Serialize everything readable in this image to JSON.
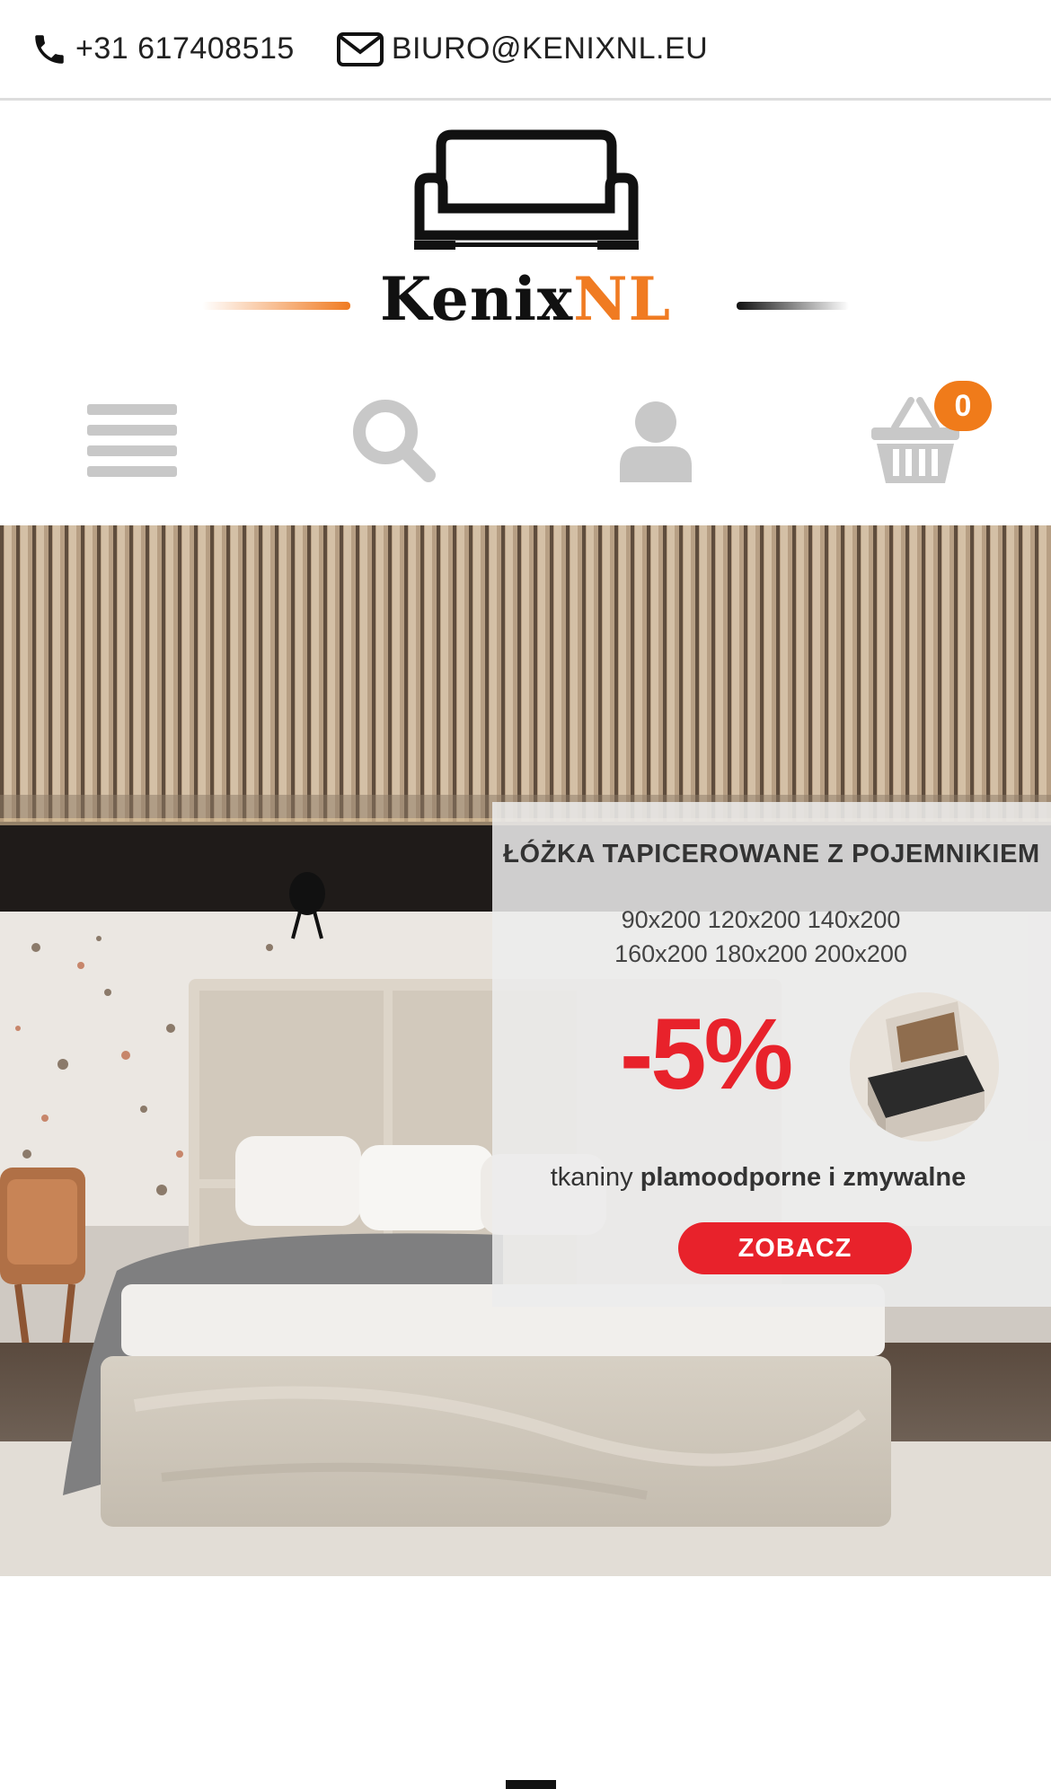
{
  "topbar": {
    "phone": "+31 617408515",
    "email": "BIURO@KENIXNL.EU",
    "phone_icon": "phone-icon",
    "email_icon": "envelope-icon"
  },
  "logo": {
    "text_main": "Kenix",
    "text_accent": "NL",
    "icon": "sofa-icon"
  },
  "nav": {
    "icons": [
      "menu-icon",
      "search-icon",
      "user-icon",
      "cart-icon"
    ],
    "cart_count": "0"
  },
  "hero": {
    "title": "ŁÓŻKA TAPICEROWANE Z POJEMNIKIEM",
    "sizes_line1": "90x200 120x200 140x200",
    "sizes_line2": "160x200 180x200 200x200",
    "discount": "-5%",
    "fabric_prefix": "tkaniny ",
    "fabric_bold": "plamoodporne i zmywalne",
    "button": "ZOBACZ"
  },
  "colors": {
    "accent": "#f07b22",
    "promo_red": "#e8222b",
    "icon_gray": "#c8c8c8",
    "badge": "#f07b1a"
  }
}
